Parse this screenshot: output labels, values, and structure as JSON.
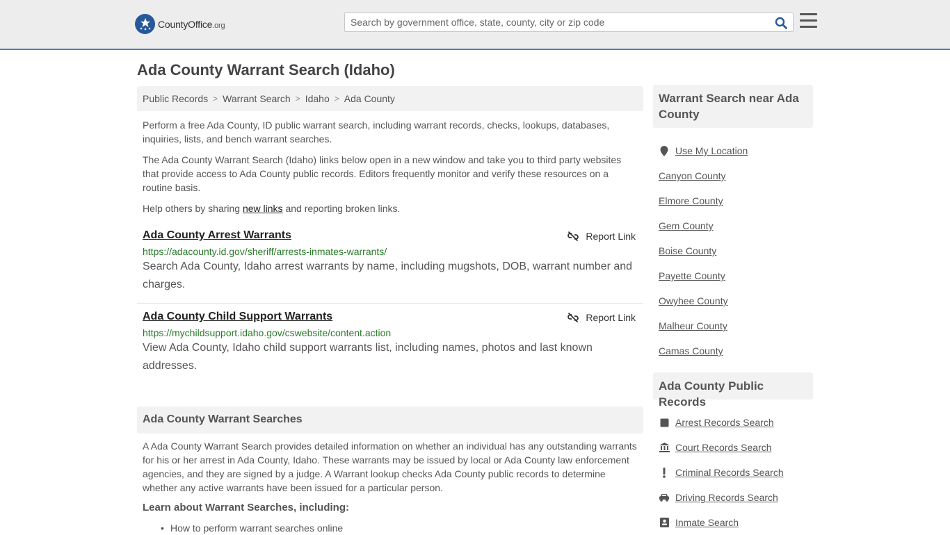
{
  "header": {
    "logo_main": "CountyOffice",
    "logo_tld": ".org",
    "search_placeholder": "Search by government office, state, county, city or zip code"
  },
  "page": {
    "title": "Ada County Warrant Search (Idaho)"
  },
  "breadcrumb": [
    "Public Records",
    "Warrant Search",
    "Idaho",
    "Ada County"
  ],
  "intro": {
    "p1": "Perform a free Ada County, ID public warrant search, including warrant records, checks, lookups, databases, inquiries, lists, and bench warrant searches.",
    "p2": "The Ada County Warrant Search (Idaho) links below open in a new window and take you to third party websites that provide access to Ada County public records. Editors frequently monitor and verify these resources on a routine basis.",
    "p3_before": "Help others by sharing ",
    "p3_link": "new links",
    "p3_after": " and reporting broken links."
  },
  "resources": [
    {
      "title": "Ada County Arrest Warrants",
      "url": "https://adacounty.id.gov/sheriff/arrests-inmates-warrants/",
      "description": "Search Ada County, Idaho arrest warrants by name, including mugshots, DOB, warrant number and charges.",
      "report_label": "Report Link"
    },
    {
      "title": "Ada County Child Support Warrants",
      "url": "https://mychildsupport.idaho.gov/cswebsite/content.action",
      "description": "View Ada County, Idaho child support warrants list, including names, photos and last known addresses.",
      "report_label": "Report Link"
    }
  ],
  "section": {
    "heading": "Ada County Warrant Searches",
    "body": "A Ada County Warrant Search provides detailed information on whether an individual has any outstanding warrants for his or her arrest in Ada County, Idaho. These warrants may be issued by local or Ada County law enforcement agencies, and they are signed by a judge. A Warrant lookup checks Ada County public records to determine whether any active warrants have been issued for a particular person.",
    "learn_heading": "Learn about Warrant Searches, including:",
    "bullet_1": "How to perform warrant searches online"
  },
  "sidebar": {
    "nearby_heading": "Warrant Search near Ada County",
    "nearby": [
      {
        "label": "Use My Location",
        "icon": "location-pin-icon"
      },
      {
        "label": "Canyon County"
      },
      {
        "label": "Elmore County"
      },
      {
        "label": "Gem County"
      },
      {
        "label": "Boise County"
      },
      {
        "label": "Payette County"
      },
      {
        "label": "Owyhee County"
      },
      {
        "label": "Malheur County"
      },
      {
        "label": "Camas County"
      }
    ],
    "records_heading": "Ada County Public Records",
    "records": [
      {
        "label": "Arrest Records Search",
        "icon": "square-icon"
      },
      {
        "label": "Court Records Search",
        "icon": "courthouse-icon"
      },
      {
        "label": "Criminal Records Search",
        "icon": "exclamation-icon"
      },
      {
        "label": "Driving Records Search",
        "icon": "car-icon"
      },
      {
        "label": "Inmate Search",
        "icon": "id-card-icon"
      }
    ]
  },
  "colors": {
    "brand_blue": "#26589c",
    "header_border": "#4b7dbd",
    "url_green": "#2a7a2a"
  }
}
